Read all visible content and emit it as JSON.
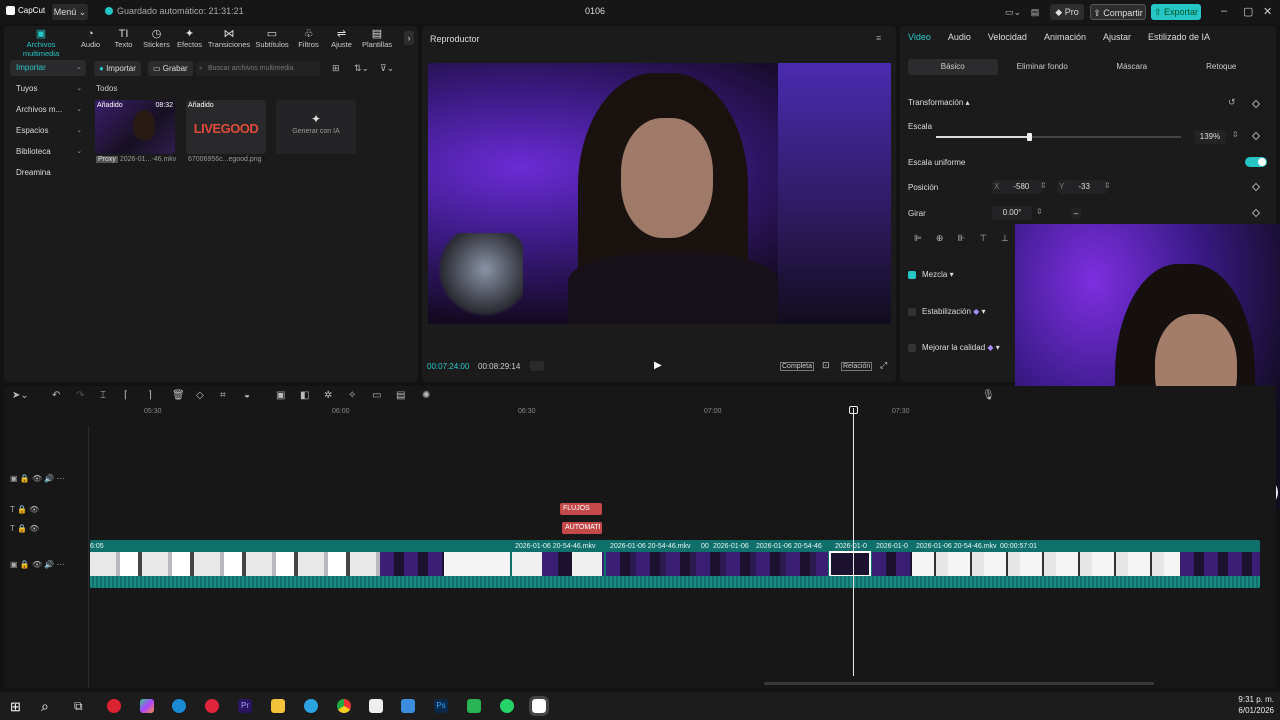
{
  "app": {
    "logo": "CapCut",
    "menu": "Menú",
    "saved": "Guardado automático: 21:31:21",
    "doc_title": "0106",
    "pro": "Pro",
    "share": "Compartir",
    "export": "Exportar"
  },
  "media": {
    "tabs": [
      {
        "label": "Archivos multimedia",
        "icon": "▣"
      },
      {
        "label": "Audio",
        "icon": "◔"
      },
      {
        "label": "Texto",
        "icon": "TI"
      },
      {
        "label": "Stickers",
        "icon": "◷"
      },
      {
        "label": "Efectos",
        "icon": "✦"
      },
      {
        "label": "Transiciones",
        "icon": "⋈"
      },
      {
        "label": "Subtítulos",
        "icon": "▭"
      },
      {
        "label": "Filtros",
        "icon": "♧"
      },
      {
        "label": "Ajuste",
        "icon": "⇌"
      },
      {
        "label": "Plantillas",
        "icon": "▤"
      }
    ],
    "nav": [
      "Importar",
      "Tuyos",
      "Archivos m...",
      "Espacios",
      "Biblioteca",
      "Dreamina"
    ],
    "import_btn": "Importar",
    "record_btn": "Grabar",
    "search_placeholder": "Buscar archivos multimedia",
    "section": "Todos",
    "items": [
      {
        "tag": "Añadido",
        "duration": "08:32",
        "badge": "Proxy",
        "name": "2026-01...-46.mkv"
      },
      {
        "tag": "Añadido",
        "logo": "LIVEGOOD",
        "name": "67006956c...egood.png"
      }
    ],
    "generate": "Generar con IA"
  },
  "player": {
    "title": "Reproductor",
    "current": "00:07:24:00",
    "total": "00:08:29:14",
    "full": "Completa",
    "ratio": "Relación"
  },
  "props": {
    "tabs": [
      "Video",
      "Audio",
      "Velocidad",
      "Animación",
      "Ajustar",
      "Estilizado de IA"
    ],
    "subtabs": [
      "Básico",
      "Eliminar fondo",
      "Máscara",
      "Retoque"
    ],
    "transform": "Transformación",
    "scale": "Escala",
    "scale_value": "139%",
    "uniform": "Escala uniforme",
    "position": "Posición",
    "x_label": "X",
    "x_value": "-580",
    "y_label": "Y",
    "y_value": "-33",
    "rotate": "Girar",
    "rotate_value": "0.00°",
    "blend": "Mezcla",
    "stab": "Estabilización",
    "quality": "Mejorar la calidad",
    "scale_level": 0.38
  },
  "timeline": {
    "ruler": [
      "05:30",
      "06:00",
      "06:30",
      "07:00",
      "07:30"
    ],
    "text_clips": [
      "FLUJOS",
      "AUTOMATI"
    ],
    "clip_labels": [
      "6:05",
      "2026-01-06 20-54-46.mkv",
      "2026-01-06 20-54-46.mkv",
      "00",
      "2026-01-06",
      "2026-01-06 20-54-46",
      "2026-01-0",
      "2026-01-0",
      "2026-01-06 20-54-46.mkv",
      "00:00:57:01"
    ]
  },
  "taskbar": {
    "time": "9:31 p. m.",
    "date": "6/01/2026"
  },
  "colors": {
    "accent": "#29c7c7",
    "clip": "#0f6f6a"
  }
}
